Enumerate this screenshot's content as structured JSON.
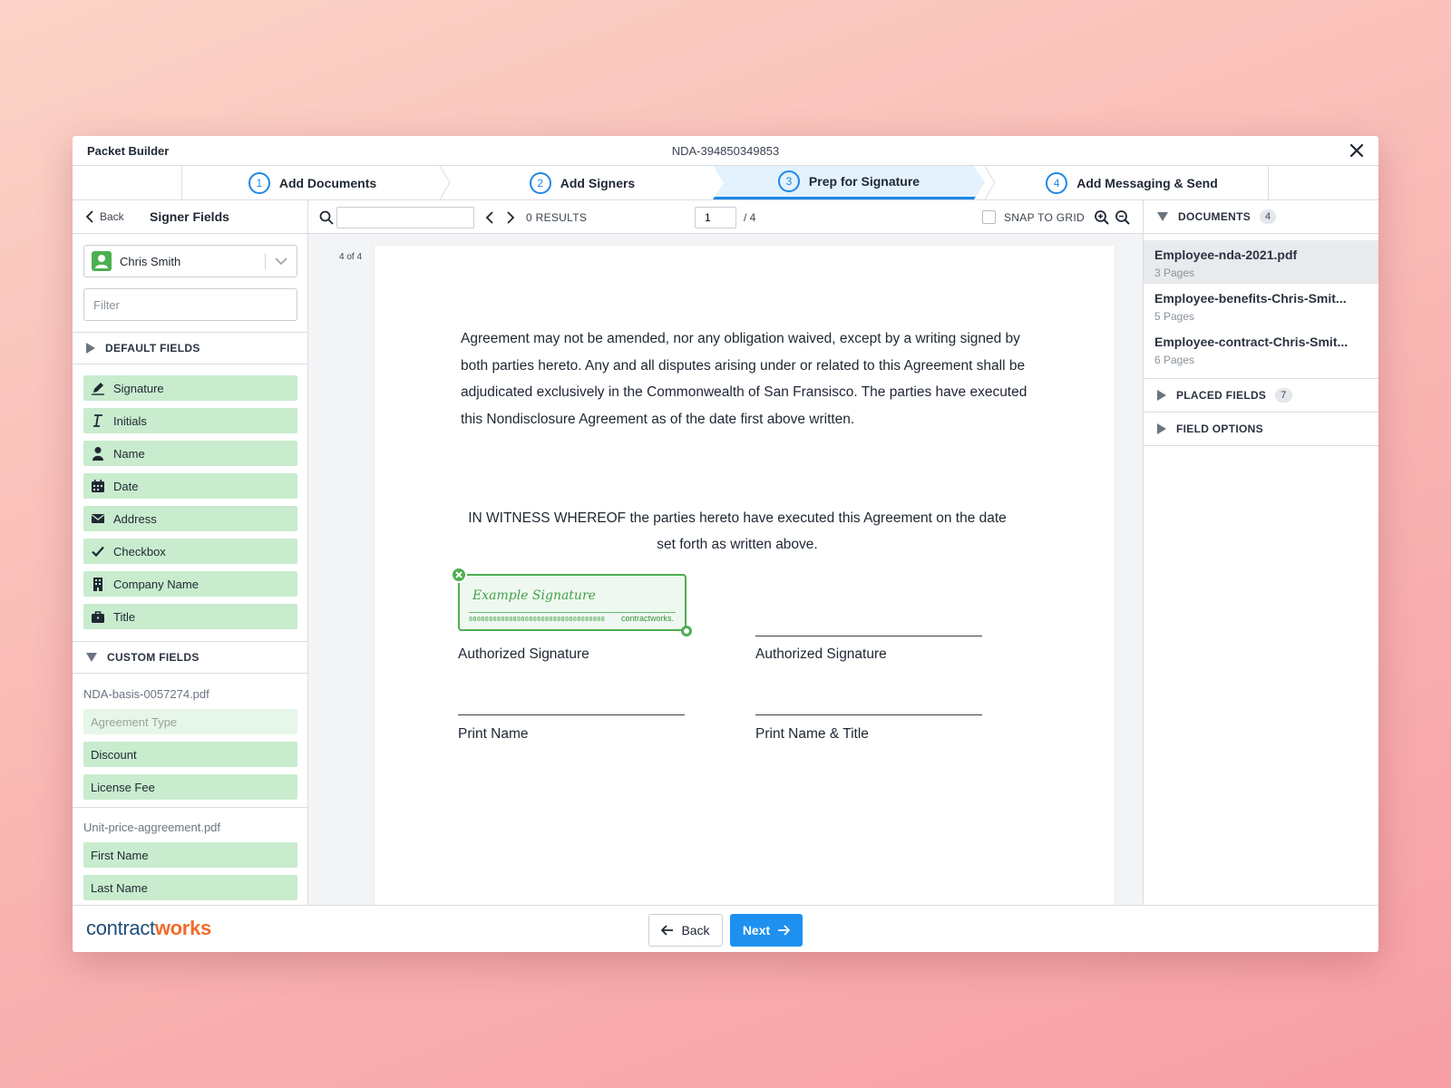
{
  "app": {
    "title": "Packet Builder",
    "doc_id": "NDA-394850349853"
  },
  "steps": [
    {
      "num": "1",
      "label": "Add Documents",
      "state": "done"
    },
    {
      "num": "2",
      "label": "Add Signers",
      "state": "done"
    },
    {
      "num": "3",
      "label": "Prep for Signature",
      "state": "active"
    },
    {
      "num": "4",
      "label": "Add Messaging & Send",
      "state": "todo"
    }
  ],
  "left": {
    "back_label": "Back",
    "title": "Signer Fields",
    "signer": "Chris Smith",
    "filter_placeholder": "Filter",
    "default_header": "DEFAULT FIELDS",
    "default_fields": [
      {
        "label": "Signature",
        "icon": "pen-icon"
      },
      {
        "label": "Initials",
        "icon": "text-cursor-icon"
      },
      {
        "label": "Name",
        "icon": "person-icon"
      },
      {
        "label": "Date",
        "icon": "calendar-icon"
      },
      {
        "label": "Address",
        "icon": "envelope-icon"
      },
      {
        "label": "Checkbox",
        "icon": "check-icon"
      },
      {
        "label": "Company Name",
        "icon": "building-icon"
      },
      {
        "label": "Title",
        "icon": "briefcase-icon"
      }
    ],
    "custom_header": "CUSTOM FIELDS",
    "custom_groups": [
      {
        "file": "NDA-basis-0057274.pdf",
        "fields": [
          "Agreement Type",
          "Discount",
          "License Fee"
        ]
      },
      {
        "file": "Unit-price-aggreement.pdf",
        "fields": [
          "First Name",
          "Last Name"
        ]
      }
    ]
  },
  "viewer": {
    "results": "0 RESULTS",
    "page_value": "1",
    "page_total": "/ 4",
    "snap_label": "SNAP TO GRID",
    "page_counter": "4 of 4",
    "paragraph": "Agreement may not be amended, nor any obligation waived, except by a writing signed by both parties hereto. Any and all disputes arising under or related to this Agreement shall be adjudicated exclusively in the Commonwealth of San Fransisco. The parties have executed this Nondisclosure Agreement as of the date first above written.",
    "witness": "IN WITNESS WHEREOF the parties hereto have executed this Agreement on the date set forth as written above.",
    "signature_example": "Example Signature",
    "signature_digits": "0808080808080808080808080808080808",
    "signature_brand": "contractworks.",
    "labels": {
      "auth_sig_left": "Authorized Signature",
      "auth_sig_right": "Authorized Signature",
      "print_name": "Print Name",
      "print_name_title": "Print Name & Title"
    }
  },
  "right": {
    "documents_header": "DOCUMENTS",
    "documents_count": "4",
    "documents": [
      {
        "name": "Employee-nda-2021.pdf",
        "pages": "3 Pages"
      },
      {
        "name": "Employee-benefits-Chris-Smit...",
        "pages": "5 Pages"
      },
      {
        "name": "Employee-contract-Chris-Smit...",
        "pages": "6 Pages"
      }
    ],
    "placed_header": "PLACED FIELDS",
    "placed_count": "7",
    "options_header": "FIELD OPTIONS"
  },
  "footer": {
    "brand_a": "contract",
    "brand_b": "works",
    "back_label": "Back",
    "next_label": "Next"
  },
  "colors": {
    "accent": "#1e88e5",
    "field_green": "#c8eccd",
    "brand_orange": "#f26b2a",
    "brand_navy": "#1f4e79"
  }
}
